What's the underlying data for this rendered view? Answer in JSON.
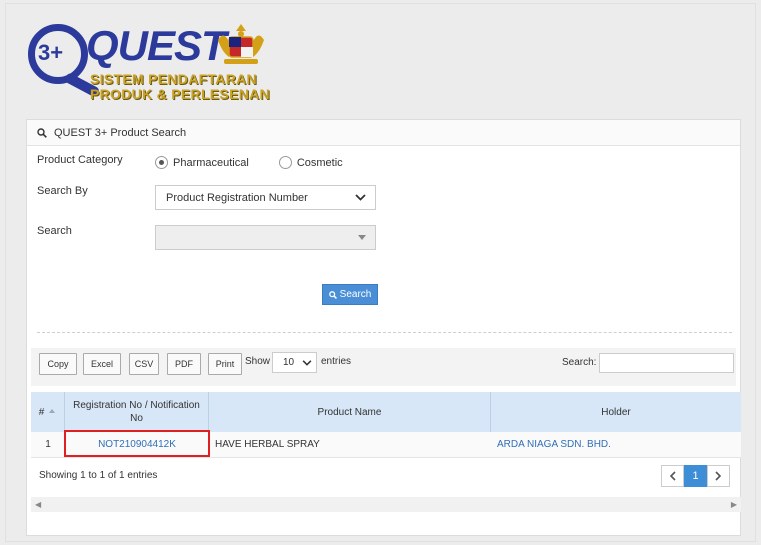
{
  "logo": {
    "badge_text": "3+",
    "word": "QUEST",
    "subtitle_line1": "SISTEM PENDAFTARAN",
    "subtitle_line2": "PRODUK & PERLESENAN"
  },
  "panel": {
    "title": "QUEST 3+ Product Search",
    "icons": {
      "title": "search-icon"
    }
  },
  "form": {
    "category_label": "Product Category",
    "category_options": [
      "Pharmaceutical",
      "Cosmetic"
    ],
    "category_selected": "Pharmaceutical",
    "search_by_label": "Search By",
    "search_by_value": "Product Registration Number",
    "search_label": "Search",
    "search_value": "",
    "search_button": "Search"
  },
  "toolbar": {
    "buttons": [
      "Copy",
      "Excel",
      "CSV",
      "PDF",
      "Print"
    ],
    "show_label": "Show",
    "page_length": "10",
    "entries_label": "entries",
    "search_label": "Search:"
  },
  "table": {
    "columns": [
      "#",
      "Registration No / Notification No",
      "Product Name",
      "Holder"
    ],
    "rows": [
      {
        "index": "1",
        "reg_no": "NOT210904412K",
        "product": "HAVE HERBAL SPRAY",
        "holder": "ARDA NIAGA SDN. BHD."
      }
    ]
  },
  "footer": {
    "info": "Showing 1 to 1 of 1 entries",
    "current_page": "1"
  },
  "colors": {
    "primary": "#4a8fd6",
    "header_bg": "#d7e7f7",
    "link": "#2f6fb7",
    "highlight": "#e02020",
    "logo_blue": "#2b3a9b",
    "logo_gold": "#c9a227"
  }
}
